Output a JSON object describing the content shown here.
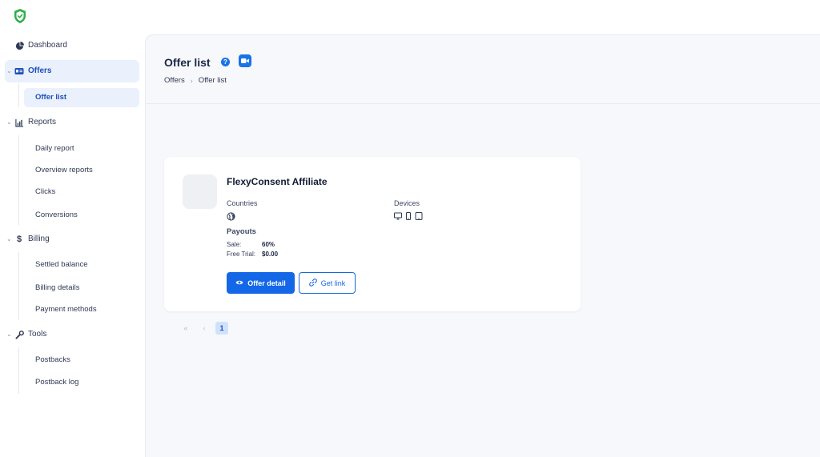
{
  "sidebar": {
    "items": [
      {
        "label": "Dashboard",
        "icon": "pie-chart-icon"
      },
      {
        "label": "Offers",
        "icon": "id-card-icon"
      },
      {
        "label": "Reports",
        "icon": "bar-chart-icon"
      },
      {
        "label": "Billing",
        "icon": "dollar-icon"
      },
      {
        "label": "Tools",
        "icon": "wrench-icon"
      }
    ],
    "offers_sub": [
      "Offer list"
    ],
    "reports_sub": [
      "Daily report",
      "Overview reports",
      "Clicks",
      "Conversions"
    ],
    "billing_sub": [
      "Settled balance",
      "Billing details",
      "Payment methods"
    ],
    "tools_sub": [
      "Postbacks",
      "Postback log"
    ]
  },
  "header": {
    "title": "Offer list",
    "help_glyph": "?",
    "breadcrumb": [
      "Offers",
      "Offer list"
    ],
    "breadcrumb_sep": "›"
  },
  "offer": {
    "name": "FlexyConsent Affiliate",
    "countries_label": "Countries",
    "devices_label": "Devices",
    "payouts_label": "Payouts",
    "payouts": [
      {
        "key": "Sale:",
        "value": "60%"
      },
      {
        "key": "Free Trial:",
        "value": "$0.00"
      }
    ],
    "detail_button": "Offer detail",
    "link_button": "Get link"
  },
  "pagination": {
    "first": "«",
    "prev": "‹",
    "current": "1"
  },
  "colors": {
    "accent": "#1467e6",
    "active_bg": "#eaf1fd",
    "logo": "#2fae4f"
  }
}
